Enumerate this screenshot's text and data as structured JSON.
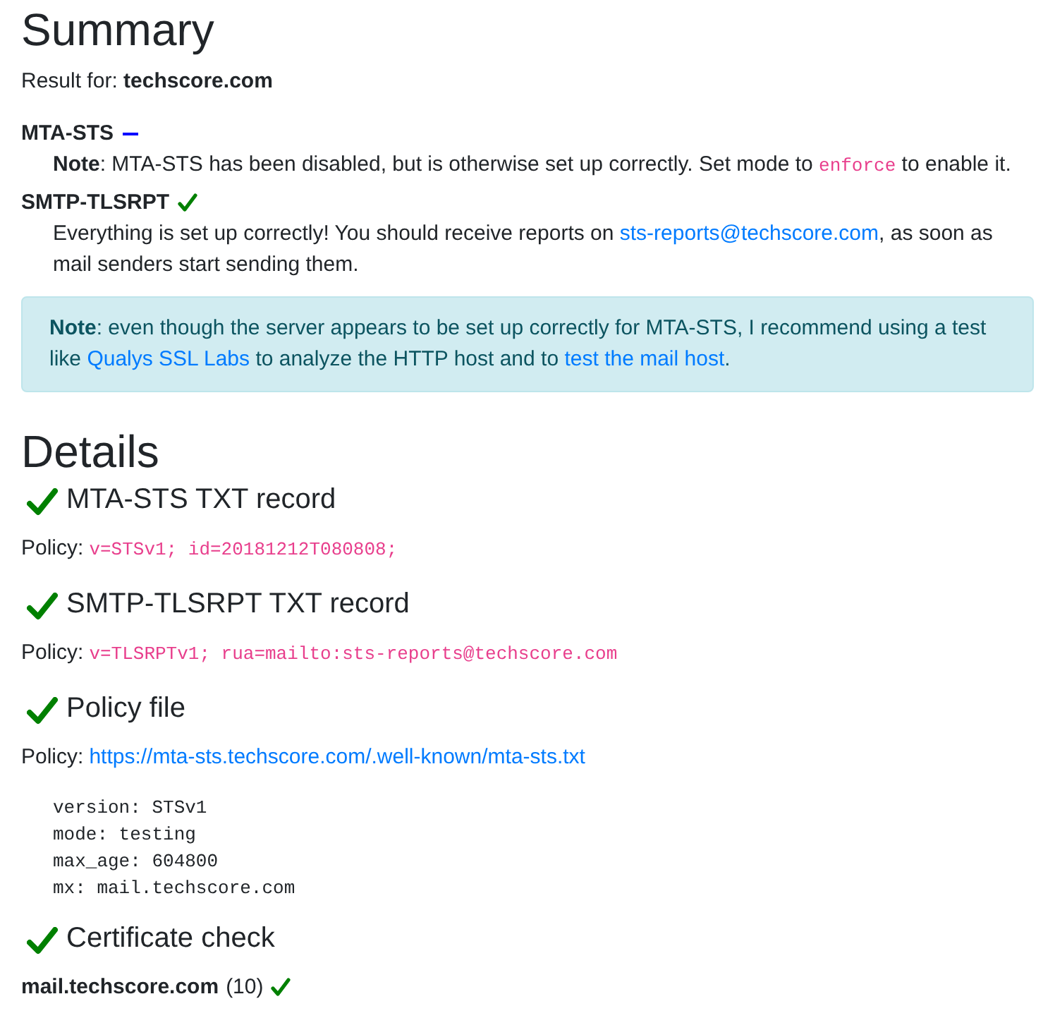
{
  "summary": {
    "title": "Summary",
    "result_label": "Result for:",
    "domain": "techscore.com",
    "items": [
      {
        "name": "MTA-STS",
        "enabled": false,
        "text": [
          {
            "kind": "text",
            "text": "**Note**: MTA-STS has been disabled, but is otherwise set up correctly. Set mode to "
          },
          {
            "kind": "code",
            "text": "enforce"
          },
          {
            "kind": "text",
            "text": " to enable it."
          }
        ]
      },
      {
        "name": "SMTP-TLSRPT",
        "enabled": true,
        "text": [
          {
            "kind": "text",
            "text": "Everything is set up correctly! You should receive reports on "
          },
          {
            "kind": "link",
            "text": "sts-reports@techscore.com"
          },
          {
            "kind": "text",
            "text": ", as soon as mail senders start sending them."
          }
        ]
      }
    ],
    "alert": [
      {
        "kind": "text",
        "text": "**Note**: even though the server appears to be set up correctly for MTA-STS, I recommend using a test like "
      },
      {
        "kind": "link",
        "text": "Qualys SSL Labs"
      },
      {
        "kind": "text",
        "text": " to analyze the HTTP host and to "
      },
      {
        "kind": "link",
        "text": "test the mail host"
      },
      {
        "kind": "text",
        "text": "."
      }
    ]
  },
  "details": {
    "title": "Details",
    "sections": [
      {
        "kind": "policy",
        "title": "MTA-STS TXT record",
        "passed": true,
        "label": "Policy:",
        "code": "v=STSv1; id=20181212T080808;"
      },
      {
        "kind": "policy",
        "title": "SMTP-TLSRPT TXT record",
        "passed": true,
        "label": "Policy:",
        "code": "v=TLSRPTv1; rua=mailto:sts-reports@techscore.com"
      },
      {
        "kind": "policy",
        "title": "Policy file",
        "passed": true,
        "label": "Policy:",
        "link": "https://mta-sts.techscore.com/.well-known/mta-sts.txt",
        "file_lines": [
          "version: STSv1",
          "mode: testing",
          "max_age: 604800",
          "mx: mail.techscore.com"
        ]
      },
      {
        "kind": "hosts",
        "title": "Certificate check",
        "passed": true,
        "hosts": [
          {
            "name": "mail.techscore.com",
            "count": "(10)",
            "passed": true
          }
        ]
      }
    ]
  }
}
